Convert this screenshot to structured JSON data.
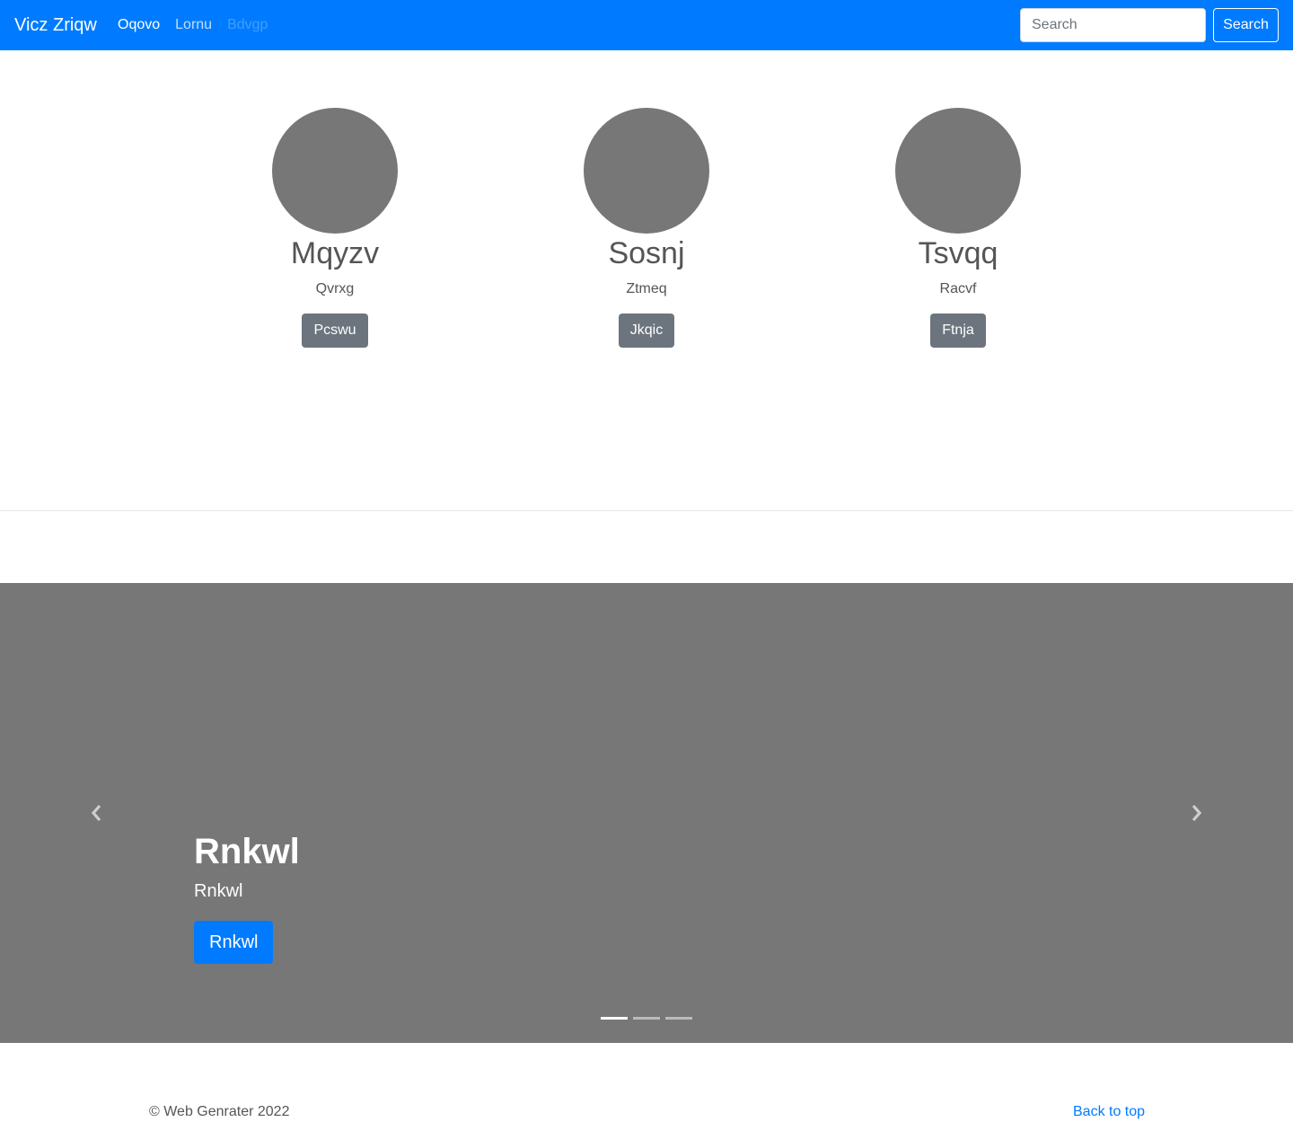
{
  "navbar": {
    "brand": "Vicz Zriqw",
    "links": [
      {
        "label": "Oqovo",
        "state": "active"
      },
      {
        "label": "Lornu",
        "state": "normal"
      },
      {
        "label": "Bdvgp",
        "state": "disabled"
      }
    ],
    "search_placeholder": "Search",
    "search_button": "Search"
  },
  "features": [
    {
      "title": "Mqyzv",
      "subtitle": "Qvrxg",
      "button": "Pcswu"
    },
    {
      "title": "Sosnj",
      "subtitle": "Ztmeq",
      "button": "Jkqic"
    },
    {
      "title": "Tsvqq",
      "subtitle": "Racvf",
      "button": "Ftnja"
    }
  ],
  "carousel": {
    "title": "Rnkwl",
    "text": "Rnkwl",
    "button": "Rnkwl",
    "slide_count": 3,
    "active_slide": 1
  },
  "footer": {
    "copyright": "© Web Genrater 2022",
    "back_to_top": "Back to top"
  },
  "colors": {
    "primary": "#007bff",
    "secondary": "#6c757d",
    "placeholder_gray": "#777777"
  }
}
